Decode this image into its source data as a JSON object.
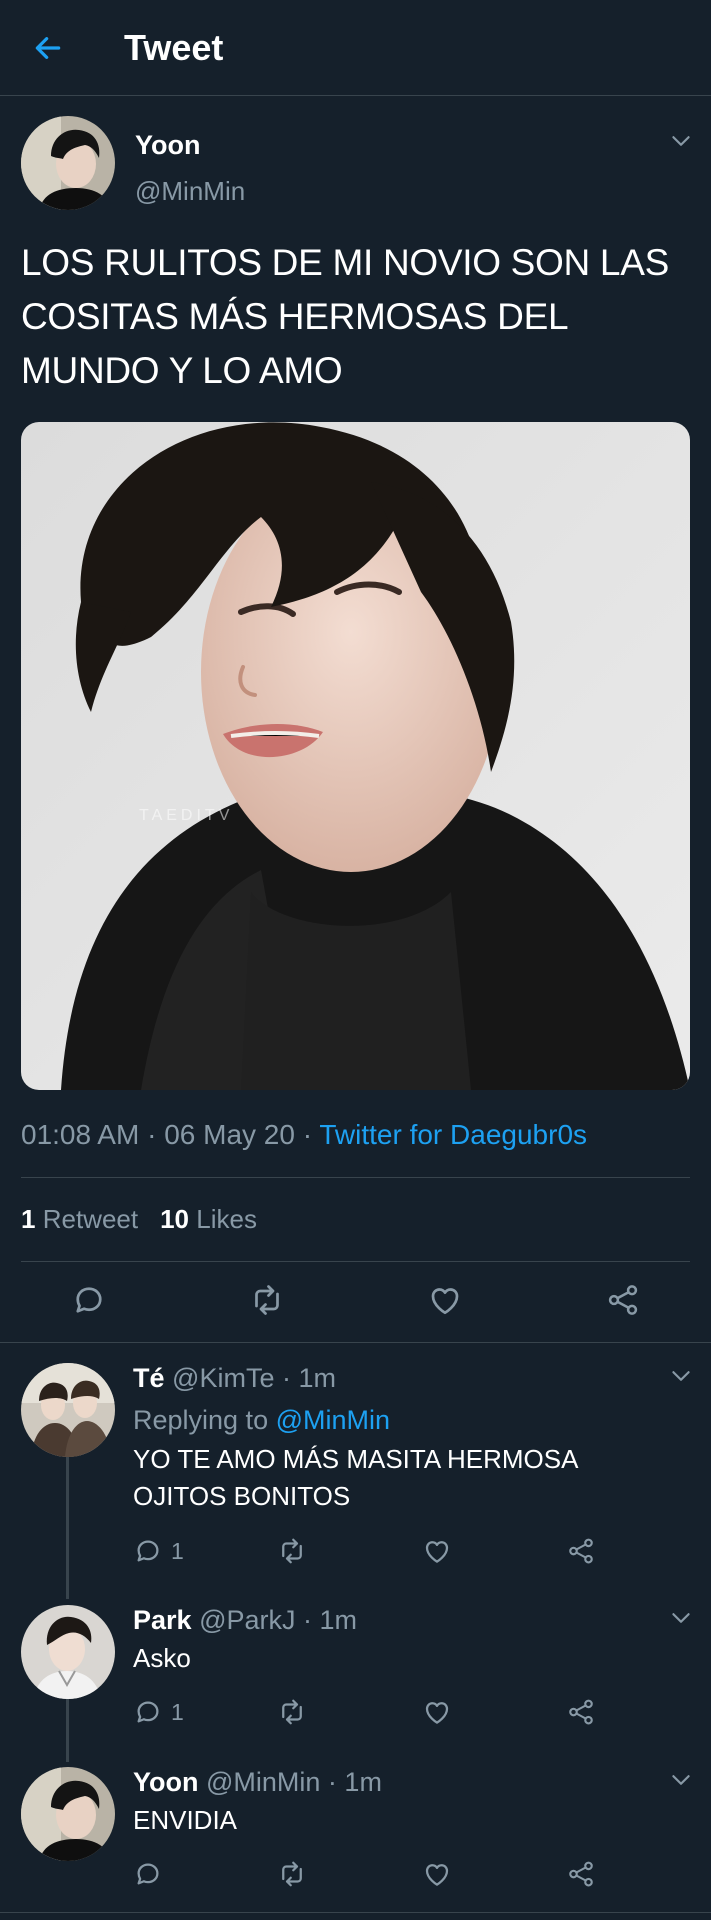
{
  "header": {
    "title": "Tweet",
    "back_icon": "arrow-left-icon"
  },
  "colors": {
    "background": "#15202b",
    "accent": "#1da1f2",
    "muted": "#8899a6",
    "divider": "#38444d"
  },
  "main_tweet": {
    "name": "Yoon",
    "handle": "@MinMin",
    "text": "LOS RULITOS DE MI NOVIO SON LAS COSITAS MÁS HERMOSAS DEL MUNDO Y LO AMO",
    "media_watermark": "TAEDITV",
    "time": "01:08 AM",
    "date": "06 May 20",
    "source": "Twitter for Daegubr0s",
    "retweets_count": "1",
    "retweets_label": "Retweet",
    "likes_count": "10",
    "likes_label": "Likes",
    "actions": [
      "reply-icon",
      "retweet-icon",
      "like-icon",
      "share-icon"
    ]
  },
  "replies": [
    {
      "name": "Té",
      "handle": "@KimTe",
      "time": "1m",
      "replying_prefix": "Replying to",
      "replying_to": "@MinMin",
      "text": "YO TE AMO MÁS MASITA HERMOSA OJITOS BONITOS",
      "reply_count": "1"
    },
    {
      "name": "Park",
      "handle": "@ParkJ",
      "time": "1m",
      "text": "Asko",
      "reply_count": "1"
    },
    {
      "name": "Yoon",
      "handle": "@MinMin",
      "time": "1m",
      "text": "ENVIDIA",
      "reply_count": ""
    }
  ]
}
